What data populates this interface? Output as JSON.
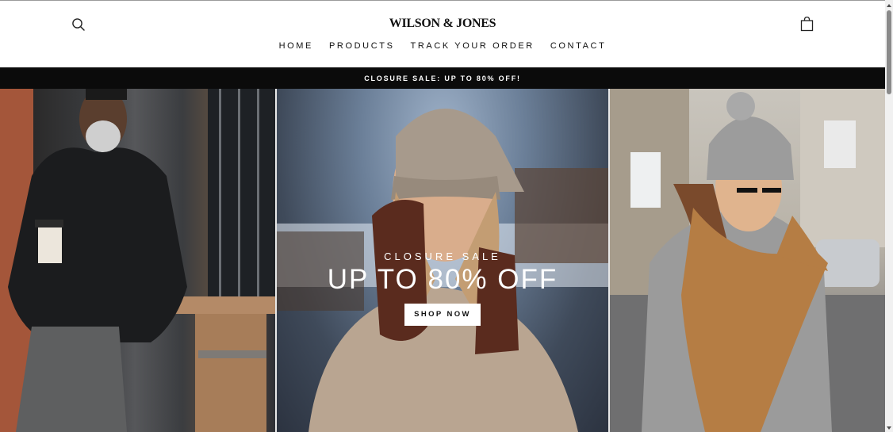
{
  "header": {
    "logo_text": "WILSON & JONES",
    "search_icon": "search-icon",
    "cart_icon": "shopping-bag-icon"
  },
  "nav": {
    "items": [
      "HOME",
      "PRODUCTS",
      "TRACK YOUR ORDER",
      "CONTACT"
    ]
  },
  "announcement": {
    "text": "CLOSURE SALE: UP TO 80% OFF!"
  },
  "hero": {
    "eyebrow": "CLOSURE SALE",
    "headline": "UP TO 80% OFF",
    "cta_label": "SHOP NOW",
    "images": [
      "man-with-coffee-photo",
      "woman-in-beanie-photo",
      "woman-with-scarf-photo"
    ]
  },
  "colors": {
    "announcement_bg": "#0b0b0b",
    "text": "#111111",
    "background": "#ffffff"
  }
}
